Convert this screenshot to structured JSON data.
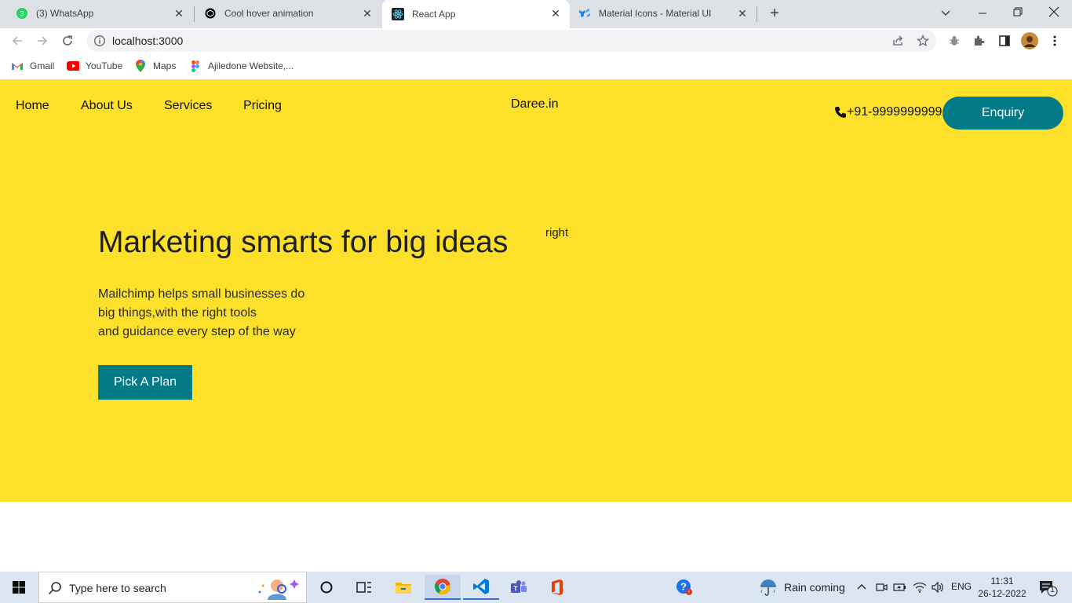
{
  "browser": {
    "tabs": [
      {
        "title": "(3) WhatsApp",
        "icon": "whatsapp-icon",
        "active": false
      },
      {
        "title": "Cool hover animation",
        "icon": "codepen-icon",
        "active": false
      },
      {
        "title": "React App",
        "icon": "react-icon",
        "active": true
      },
      {
        "title": "Material Icons - Material UI",
        "icon": "mui-icon",
        "active": false
      }
    ],
    "new_tab": "+",
    "url": "localhost:3000",
    "bookmarks": [
      {
        "label": "Gmail",
        "icon": "gmail-icon"
      },
      {
        "label": "YouTube",
        "icon": "youtube-icon"
      },
      {
        "label": "Maps",
        "icon": "maps-icon"
      },
      {
        "label": "Ajiledone Website,...",
        "icon": "figma-icon"
      }
    ]
  },
  "site": {
    "nav": [
      "Home",
      "About Us",
      "Services",
      "Pricing"
    ],
    "brand": "Daree.in",
    "phone": "+91-9999999999",
    "enquiry": "Enquiry",
    "headline": "Marketing smarts for big ideas",
    "right_label": "right",
    "description": [
      "Mailchimp helps small businesses do",
      "big things,with the right tools",
      "and guidance every step of the way"
    ],
    "cta": "Pick A Plan",
    "colors": {
      "background": "#fde02a",
      "accent": "#037a87"
    }
  },
  "taskbar": {
    "search_placeholder": "Type here to search",
    "weather": "Rain coming",
    "language": "ENG",
    "time": "11:31",
    "date": "26-12-2022",
    "notifications": "1"
  }
}
